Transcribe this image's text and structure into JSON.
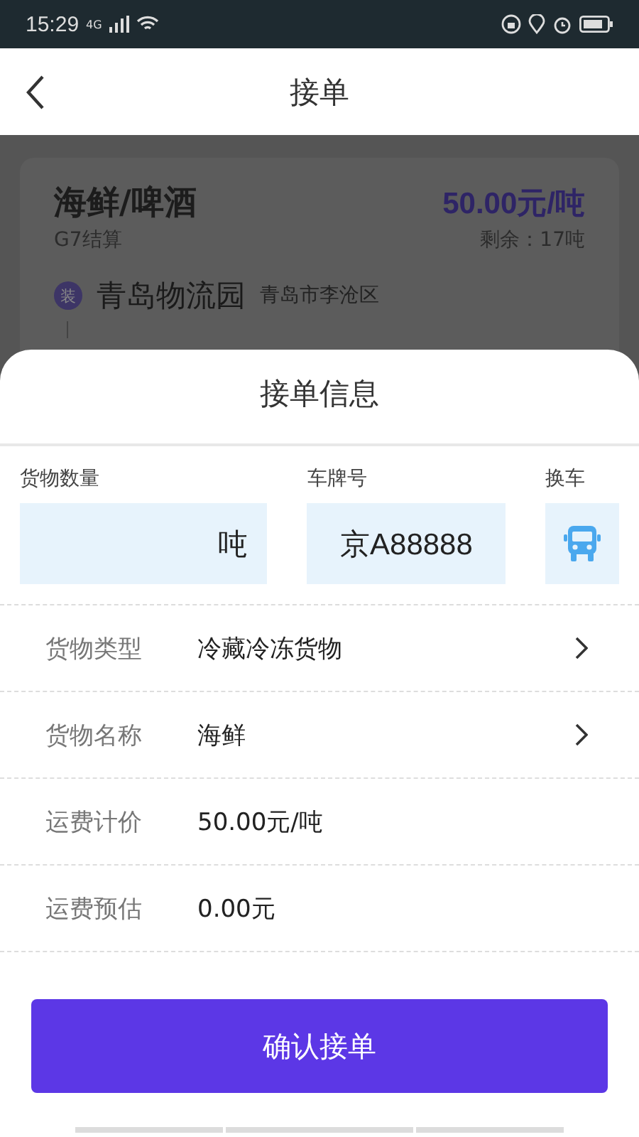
{
  "status_bar": {
    "time": "15:29",
    "network": "4G"
  },
  "header": {
    "title": "接单"
  },
  "card": {
    "title": "海鲜/啤酒",
    "price": "50.00元/吨",
    "settlement": "G7结算",
    "remaining": "剩余：17吨",
    "origin": {
      "badge": "装",
      "name": "青岛物流园",
      "district": "青岛市李沧区"
    }
  },
  "sheet": {
    "title": "接单信息",
    "quantity": {
      "label": "货物数量",
      "unit": "吨"
    },
    "plate": {
      "label": "车牌号",
      "value": "京A88888"
    },
    "change_vehicle": {
      "label": "换车"
    },
    "rows": [
      {
        "label": "货物类型",
        "value": "冷藏冷冻货物",
        "kind": "link"
      },
      {
        "label": "货物名称",
        "value": "海鲜",
        "kind": "link"
      },
      {
        "label": "运费计价",
        "value": "50.00元/吨",
        "kind": "text"
      },
      {
        "label": "运费预估",
        "value": "0.00元",
        "kind": "text"
      }
    ],
    "confirm_button": "确认接单"
  }
}
